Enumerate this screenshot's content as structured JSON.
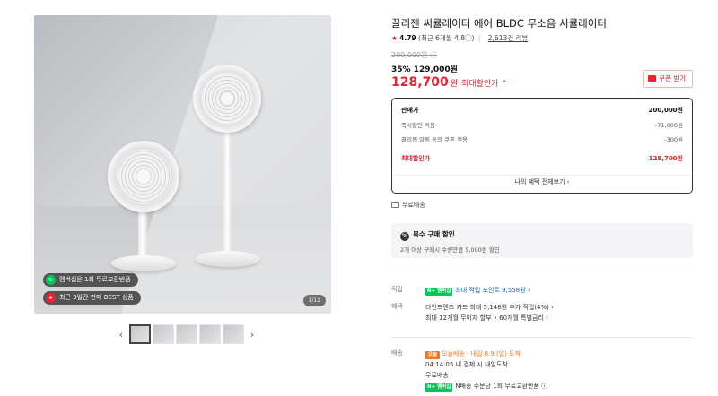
{
  "gallery": {
    "badges": [
      {
        "icon": "refresh-icon",
        "text": "멤버십은 1회 무료교환반품",
        "color": "#03c75a"
      },
      {
        "icon": "medal-icon",
        "text": "최근 3일간 판매 BEST 상품",
        "color": "#e8222e"
      }
    ],
    "counter": "1/11",
    "prev_arrow": "‹",
    "next_arrow": "›"
  },
  "product": {
    "title": "끌리젠 써큘레이터 에어 BLDC 무소음 서큘레이터",
    "rating": {
      "star": "★",
      "score": "4.79",
      "recent": "(최근 6개월 4.8ⓘ)",
      "separator": "|",
      "reviews": "2,613건 리뷰"
    },
    "original_price": "200,000원 ⓘ",
    "discount_line": "35% 129,000원",
    "max_price": {
      "number": "128,700",
      "unit": "원",
      "label": "최대할인가 ⌃"
    },
    "coupon_button": "쿠폰 받기"
  },
  "price_box": {
    "rows": [
      {
        "label": "판매가",
        "value": "200,000원"
      },
      {
        "label": "즉시할인 적용",
        "value": "-71,000원"
      },
      {
        "label": "끌리젠 알림 동의 쿠폰 적용",
        "value": "-300원"
      },
      {
        "label": "최대할인가",
        "value": "128,700원"
      }
    ],
    "all_benefits": "나의 혜택 전체보기 ›"
  },
  "shipping_note": "무료배송",
  "multi_buy": {
    "icon": "percent-icon",
    "title": "복수 구매 할인",
    "description": "2개 이상 구매시 수량만큼 5,000원 할인"
  },
  "points": {
    "label": "적립",
    "pay_badge": "N+ 멤버십",
    "text": "최대 적립 포인트 9,558원 ›"
  },
  "benefits": {
    "label": "혜택",
    "line1": "라인프렌즈 카드 최대 5,148원 추가 적립(4%) ›",
    "line2": "최대 12개월 무이자 할부 • 60개월 특별금리 ›"
  },
  "delivery": {
    "label": "배송",
    "today_badge": "오늘",
    "today_text": "오늘배송 · 내일 8.9.(일) 도착",
    "cutoff": "04:14:05  내 결제 시 내일도착",
    "free": "무료배송",
    "npay_badge": "N+ 멤버십",
    "npay_text": "N배송 주문당 1회 무료교환반품 ⓘ"
  }
}
